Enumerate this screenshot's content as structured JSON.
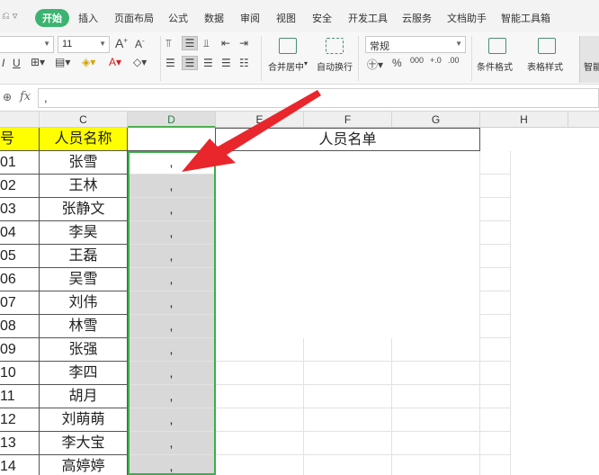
{
  "menu": {
    "quick_access": "⎌ ▿",
    "items": [
      "开始",
      "插入",
      "页面布局",
      "公式",
      "数据",
      "审阅",
      "视图",
      "安全",
      "开发工具",
      "云服务",
      "文档助手",
      "智能工具箱"
    ]
  },
  "ribbon": {
    "font_size": "11",
    "number_format": "常规",
    "merge_label": "合并居中",
    "wrap_label": "自动换行",
    "cond_format_label": "条件格式",
    "table_style_label": "表格样式",
    "smart_label": "智能"
  },
  "formula_bar": {
    "fx": "fx",
    "value": ","
  },
  "columns": [
    "C",
    "D",
    "E",
    "F",
    "G",
    "H"
  ],
  "header_row": {
    "id_col": "号",
    "name_col": "人员名称",
    "title": "人员名单"
  },
  "rows": [
    {
      "id": "01",
      "name": "张雪",
      "d": ","
    },
    {
      "id": "02",
      "name": "王林",
      "d": ","
    },
    {
      "id": "03",
      "name": "张静文",
      "d": ","
    },
    {
      "id": "04",
      "name": "李昊",
      "d": ","
    },
    {
      "id": "05",
      "name": "王磊",
      "d": ","
    },
    {
      "id": "06",
      "name": "吴雪",
      "d": ","
    },
    {
      "id": "07",
      "name": "刘伟",
      "d": ","
    },
    {
      "id": "08",
      "name": "林雪",
      "d": ","
    },
    {
      "id": "09",
      "name": "张强",
      "d": ","
    },
    {
      "id": "10",
      "name": "李四",
      "d": ","
    },
    {
      "id": "11",
      "name": "胡月",
      "d": ","
    },
    {
      "id": "12",
      "name": "刘萌萌",
      "d": ","
    },
    {
      "id": "13",
      "name": "李大宝",
      "d": ","
    },
    {
      "id": "14",
      "name": "高婷婷",
      "d": ","
    }
  ],
  "colors": {
    "accent_green": "#3cb371",
    "arrow_red": "#e8262c",
    "header_yellow": "#ffff00"
  }
}
